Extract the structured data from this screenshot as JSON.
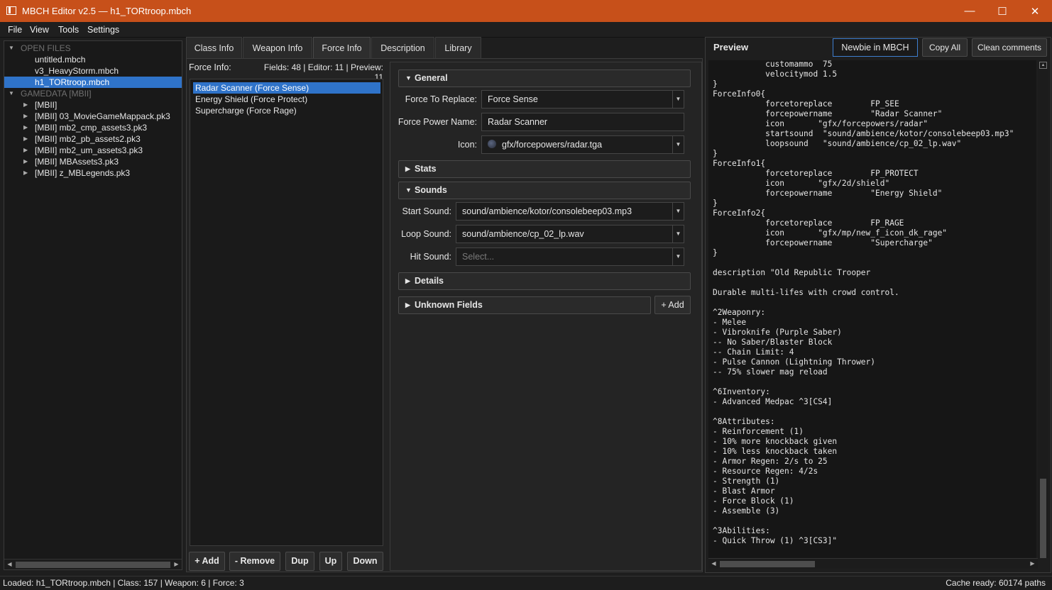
{
  "window": {
    "title": "MBCH Editor v2.5 — h1_TORtroop.mbch",
    "minimize": "—",
    "maximize": "☐",
    "close": "✕"
  },
  "menu": [
    "File",
    "View",
    "Tools",
    "Settings"
  ],
  "tree": {
    "open_files_header": "OPEN FILES",
    "open_files": [
      "untitled.mbch",
      "v3_HeavyStorm.mbch",
      "h1_TORtroop.mbch"
    ],
    "selected_file": "h1_TORtroop.mbch",
    "gamedata_header": "GAMEDATA [MBII]",
    "gamedata": [
      "[MBII]",
      "[MBII] 03_MovieGameMappack.pk3",
      "[MBII] mb2_cmp_assets3.pk3",
      "[MBII] mb2_pb_assets2.pk3",
      "[MBII] mb2_um_assets3.pk3",
      "[MBII] MBAssets3.pk3",
      "[MBII] z_MBLegends.pk3"
    ]
  },
  "tabs": [
    "Class Info",
    "Weapon Info",
    "Force Info",
    "Description",
    "Library"
  ],
  "active_tab": "Force Info",
  "force": {
    "list_label": "Force Info:",
    "counts": "Fields: 48 | Editor: 11 | Preview: 11",
    "items": [
      "Radar Scanner (Force Sense)",
      "Energy Shield (Force Protect)",
      "Supercharge (Force Rage)"
    ],
    "buttons": {
      "add": "+ Add",
      "remove": "- Remove",
      "dup": "Dup",
      "up": "Up",
      "down": "Down"
    }
  },
  "form": {
    "general": "General",
    "force_to_replace_label": "Force To Replace:",
    "force_to_replace": "Force Sense",
    "force_power_name_label": "Force Power Name:",
    "force_power_name": "Radar Scanner",
    "icon_label": "Icon:",
    "icon": "gfx/forcepowers/radar.tga",
    "stats": "Stats",
    "sounds": "Sounds",
    "start_sound_label": "Start Sound:",
    "start_sound": "sound/ambience/kotor/consolebeep03.mp3",
    "loop_sound_label": "Loop Sound:",
    "loop_sound": "sound/ambience/cp_02_lp.wav",
    "hit_sound_label": "Hit Sound:",
    "hit_sound_placeholder": "Select...",
    "details": "Details",
    "unknown_fields": "Unknown Fields",
    "add": "+ Add"
  },
  "preview": {
    "title": "Preview",
    "mode": "Newbie in MBCH",
    "copy_all": "Copy All",
    "clean_comments": "Clean comments",
    "lines": [
      "           customammo  75",
      "           velocitymod 1.5",
      "}",
      "ForceInfo0{",
      "           forcetoreplace        FP_SEE",
      "           forcepowername        \"Radar Scanner\"",
      "           icon       \"gfx/forcepowers/radar\"",
      "           startsound  \"sound/ambience/kotor/consolebeep03.mp3\"",
      "           loopsound   \"sound/ambience/cp_02_lp.wav\"",
      "}",
      "ForceInfo1{",
      "           forcetoreplace        FP_PROTECT",
      "           icon       \"gfx/2d/shield\"",
      "           forcepowername        \"Energy Shield\"",
      "}",
      "ForceInfo2{",
      "           forcetoreplace        FP_RAGE",
      "           icon       \"gfx/mp/new_f_icon_dk_rage\"",
      "           forcepowername        \"Supercharge\"",
      "}",
      "",
      "description \"Old Republic Trooper",
      "",
      "Durable multi-lifes with crowd control.",
      "",
      "^2Weaponry:",
      "- Melee",
      "- Vibroknife (Purple Saber)",
      "-- No Saber/Blaster Block",
      "-- Chain Limit: 4",
      "- Pulse Cannon (Lightning Thrower)",
      "-- 75% slower mag reload",
      "",
      "^6Inventory:",
      "- Advanced Medpac ^3[CS4]",
      "",
      "^8Attributes:",
      "- Reinforcement (1)",
      "- 10% more knockback given",
      "- 10% less knockback taken",
      "- Armor Regen: 2/s to 25",
      "- Resource Regen: 4/2s",
      "- Strength (1)",
      "- Blast Armor",
      "- Force Block (1)",
      "- Assemble (3)",
      "",
      "^3Abilities:",
      "- Quick Throw (1) ^3[CS3]\""
    ]
  },
  "status": {
    "left": "Loaded: h1_TORtroop.mbch | Class: 157 | Weapon: 6 | Force: 3",
    "right": "Cache ready: 60174 paths"
  }
}
